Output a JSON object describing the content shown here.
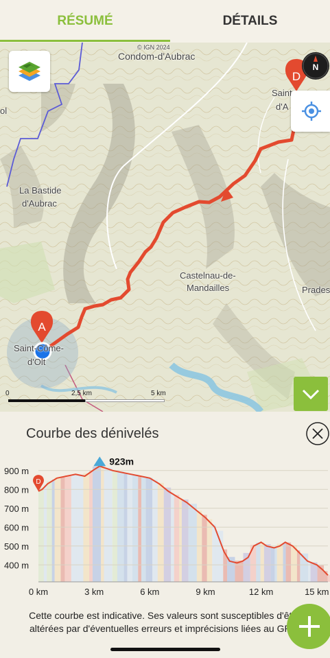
{
  "tabs": [
    {
      "label": "RÉSUMÉ",
      "active": true
    },
    {
      "label": "DÉTAILS",
      "active": false
    }
  ],
  "map": {
    "copyright": "© IGN 2024",
    "places": [
      "Condom-d'Aubrac",
      "La Bastide",
      "d'Aubrac",
      "Castelnau-de-",
      "Mandailles",
      "Prades",
      "Saint-Côme-",
      "d'Olt",
      "Saint-",
      "d'A",
      "ol"
    ],
    "markers": {
      "start": "A",
      "end": "D"
    },
    "compass_label": "N",
    "scale": {
      "zero": "0",
      "mid": "2,5 km",
      "end": "5 km"
    },
    "icons": {
      "layers": "layers-icon",
      "locate": "crosshair-icon",
      "compass": "compass-icon",
      "collapse": "chevron-down-icon"
    }
  },
  "profile": {
    "title": "Courbe des dénivelés",
    "peak_label": "923m",
    "start_marker": "D",
    "note": "Cette courbe est indicative. Ses valeurs sont susceptibles d'être altérées par d'éventuelles erreurs et imprécisions liées au GPS."
  },
  "chart_data": {
    "type": "area",
    "xlabel": "",
    "ylabel": "",
    "x_ticks": [
      "0 km",
      "3 km",
      "6 km",
      "9 km",
      "12 km",
      "15 km"
    ],
    "y_ticks": [
      "900 m",
      "800 m",
      "700 m",
      "600 m",
      "500 m",
      "400 m"
    ],
    "ylim": [
      310,
      950
    ],
    "xlim": [
      0,
      15.6
    ],
    "x": [
      0,
      0.2,
      0.5,
      1,
      2,
      2.5,
      3,
      3.3,
      4,
      5,
      5.5,
      6,
      6.5,
      7,
      7.5,
      8,
      8.5,
      9,
      9.5,
      10,
      10.3,
      10.7,
      11,
      11.3,
      11.6,
      12,
      12.3,
      12.7,
      13,
      13.3,
      13.7,
      14,
      14.5,
      15,
      15.3,
      15.6
    ],
    "y": [
      790,
      800,
      830,
      860,
      880,
      870,
      905,
      923,
      900,
      880,
      870,
      860,
      830,
      790,
      760,
      730,
      690,
      650,
      600,
      470,
      420,
      410,
      420,
      440,
      500,
      520,
      500,
      490,
      500,
      520,
      500,
      470,
      420,
      400,
      375,
      345
    ],
    "colors": {
      "line": "#e34a2f",
      "accent": "#8bbf3c",
      "marker": "#e34a2f",
      "peak": "#4aa8d8"
    }
  }
}
